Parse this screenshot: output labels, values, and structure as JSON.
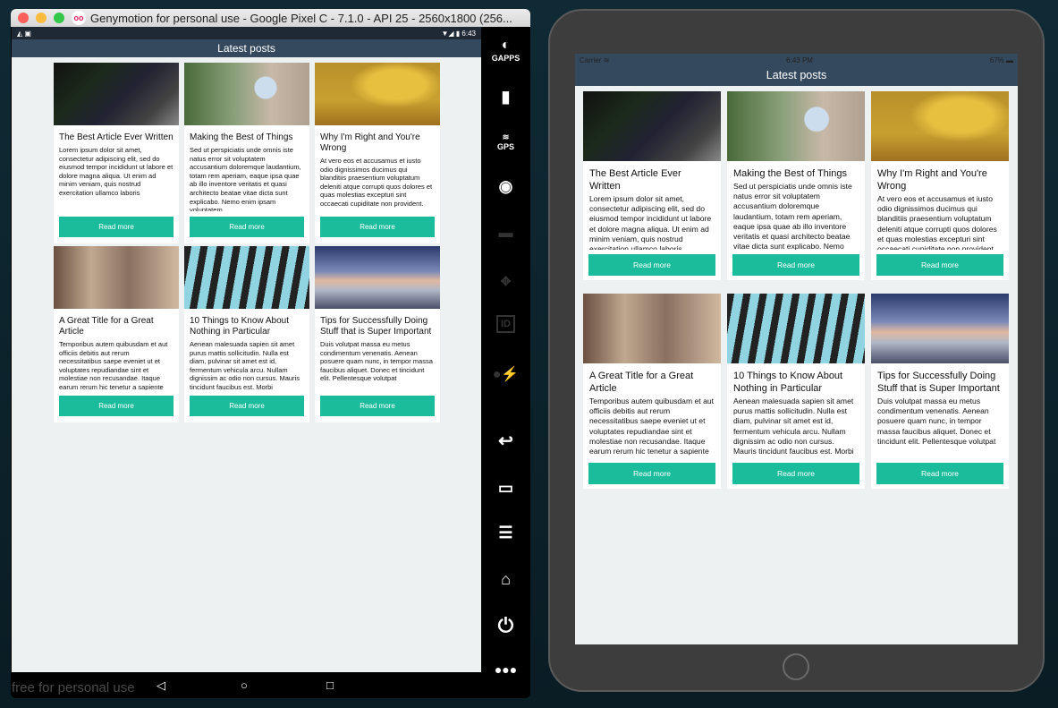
{
  "genymotion": {
    "window_title": "Genymotion for personal use - Google Pixel C - 7.1.0 - API 25 - 2560x1800 (256...",
    "status_time": "6:43",
    "watermark": "free for personal use",
    "sidebar": [
      "GAPPS",
      "Battery",
      "GPS",
      "Webcam",
      "Capture",
      "Navigation",
      "ID",
      "Disk",
      "Back",
      "Recent apps",
      "Menu",
      "Home",
      "Power",
      "More"
    ],
    "gapps_label": "GAPPS",
    "gps_label": "GPS",
    "id_label": "ID"
  },
  "ios": {
    "carrier": "Carrier",
    "time": "6:43 PM",
    "battery": "67%"
  },
  "header_title": "Latest posts",
  "read_more": "Read more",
  "posts": [
    {
      "title": "The Best Article Ever Written",
      "body": "Lorem ipsum dolor sit amet, consectetur adipiscing elit, sed do eiusmod tempor incididunt ut labore et dolore magna aliqua. Ut enim ad minim veniam, quis nostrud exercitation ullamco laboris"
    },
    {
      "title": "Making the Best of Things",
      "body": "Sed ut perspiciatis unde omnis iste natus error sit voluptatem accusantium doloremque laudantium, totam rem aperiam, eaque ipsa quae ab illo inventore veritatis et quasi architecto beatae vitae dicta sunt explicabo. Nemo enim ipsam voluptatem"
    },
    {
      "title": "Why I'm Right and You're Wrong",
      "body": "At vero eos et accusamus et iusto odio dignissimos ducimus qui blanditiis praesentium voluptatum deleniti atque corrupti quos dolores et quas molestias excepturi sint occaecati cupiditate non provident."
    },
    {
      "title": "A Great Title for a Great Article",
      "body": "Temporibus autem quibusdam et aut officiis debitis aut rerum necessitatibus saepe eveniet ut et voluptates repudiandae sint et molestiae non recusandae. Itaque earum rerum hic tenetur a sapiente"
    },
    {
      "title": "10 Things to Know About Nothing in Particular",
      "body": "Aenean malesuada sapien sit amet purus mattis sollicitudin. Nulla est diam, pulvinar sit amet est id, fermentum vehicula arcu. Nullam dignissim ac odio non cursus. Mauris tincidunt faucibus est. Morbi"
    },
    {
      "title": "Tips for Successfully Doing Stuff that is Super Important",
      "body": "Duis volutpat massa eu metus condimentum venenatis. Aenean posuere quam nunc, in tempor massa faucibus aliquet. Donec et tincidunt elit. Pellentesque volutpat"
    }
  ],
  "colors": {
    "header": "#34495e",
    "accent": "#1abc9c",
    "background": "#eef1f2"
  }
}
